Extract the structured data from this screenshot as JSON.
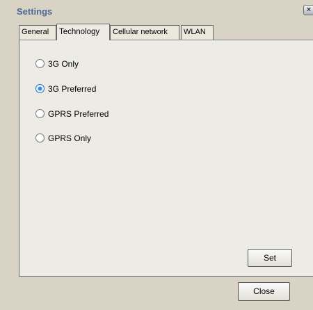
{
  "window": {
    "title": "Settings",
    "close_glyph": "×"
  },
  "tabs": [
    {
      "label": "General",
      "active": false
    },
    {
      "label": "Technology",
      "active": true
    },
    {
      "label": "Cellular network",
      "active": false
    },
    {
      "label": "WLAN",
      "active": false
    }
  ],
  "technology": {
    "options": [
      {
        "label": "3G Only",
        "selected": false
      },
      {
        "label": "3G Preferred",
        "selected": true
      },
      {
        "label": "GPRS Preferred",
        "selected": false
      },
      {
        "label": "GPRS Only",
        "selected": false
      }
    ],
    "set_label": "Set"
  },
  "footer": {
    "close_label": "Close"
  },
  "colors": {
    "title": "#4a6a94",
    "window_bg": "#d8d3c5",
    "panel_bg": "#ecebe5",
    "radio_selected": "#3a8ce0"
  }
}
